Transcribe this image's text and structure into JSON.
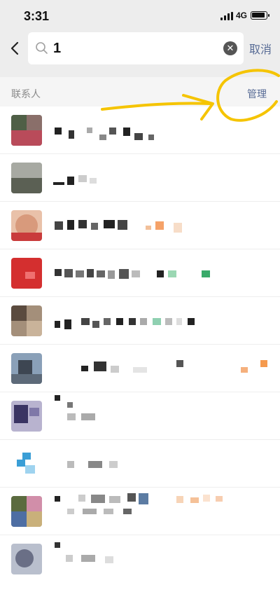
{
  "status": {
    "time": "3:31",
    "network": "4G"
  },
  "search": {
    "query": "1",
    "cancel_label": "取消"
  },
  "section": {
    "title": "联系人",
    "manage_label": "管理"
  },
  "contacts_count": 10,
  "colors": {
    "accent": "#576b95",
    "annotation": "#f5c400",
    "background": "#ededed"
  },
  "icons": [
    "back-arrow-icon",
    "search-icon",
    "clear-icon",
    "signal-icon",
    "battery-icon"
  ]
}
